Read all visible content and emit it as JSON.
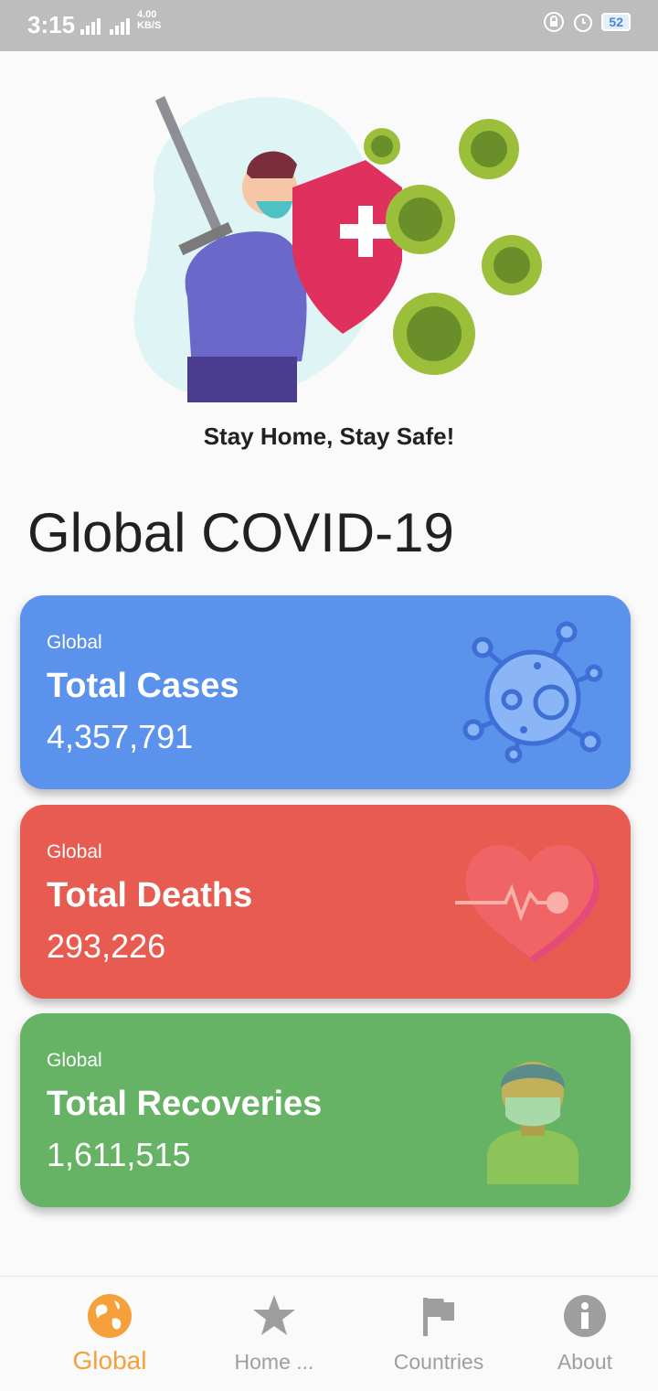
{
  "status": {
    "time": "3:15",
    "net_speed": "4.00",
    "net_unit": "KB/S",
    "battery": "52"
  },
  "hero": {
    "tagline": "Stay Home, Stay Safe!"
  },
  "page": {
    "title": "Global COVID-19"
  },
  "cards": [
    {
      "subtitle": "Global",
      "title": "Total Cases",
      "value": "4,357,791",
      "color": "#5b92ec",
      "icon": "virus-icon"
    },
    {
      "subtitle": "Global",
      "title": "Total Deaths",
      "value": "293,226",
      "color": "#e85b50",
      "icon": "heart-pulse-icon"
    },
    {
      "subtitle": "Global",
      "title": "Total Recoveries",
      "value": "1,611,515",
      "color": "#67b366",
      "icon": "masked-person-icon"
    }
  ],
  "nav": {
    "items": [
      {
        "label": "Global",
        "icon": "globe-icon",
        "active": true
      },
      {
        "label": "Home ...",
        "icon": "star-icon"
      },
      {
        "label": "Countries",
        "icon": "flag-icon"
      },
      {
        "label": "About",
        "icon": "info-icon"
      }
    ],
    "active_color": "#f5a03a"
  }
}
